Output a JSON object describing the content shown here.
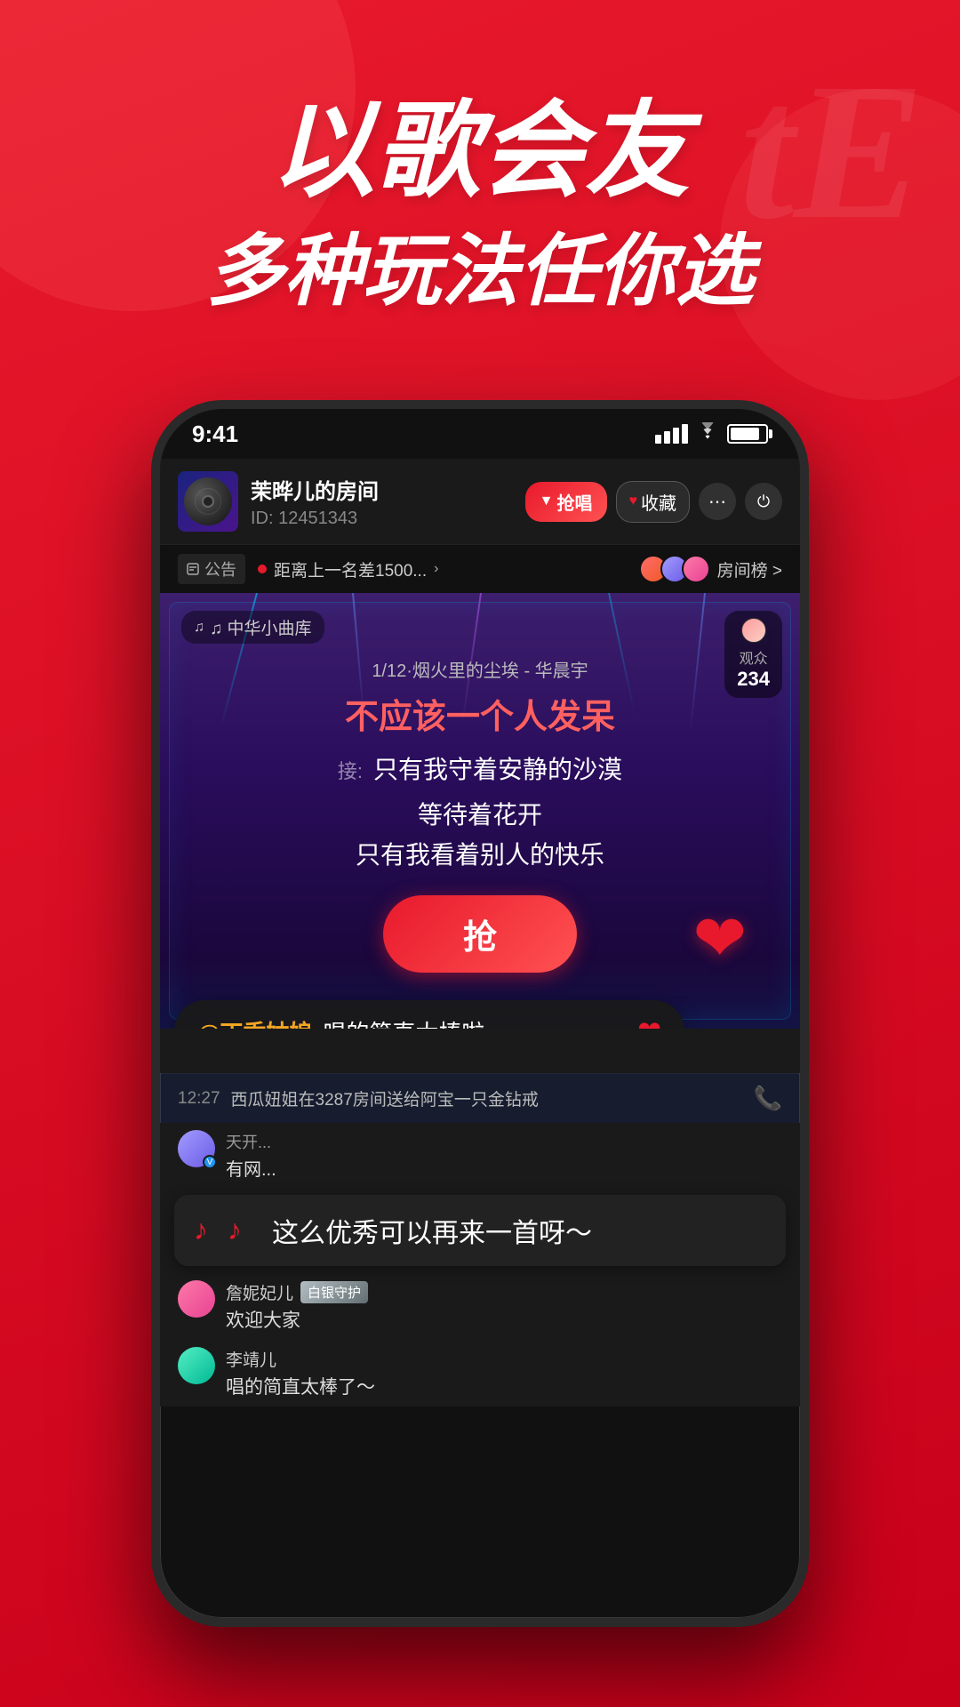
{
  "background": {
    "color": "#e8192c"
  },
  "hero": {
    "line1": "以歌会友",
    "line2": "多种玩法任你选"
  },
  "phone": {
    "status": {
      "time": "9:41"
    },
    "room": {
      "name": "茉晔儿的房间",
      "id": "ID: 12451343",
      "btn_qiang": "抢唱",
      "btn_collect": "收藏",
      "more": "⋯",
      "power": "⏻"
    },
    "notice": {
      "tag": "公告",
      "dot": true,
      "text": "距离上一名差1500...",
      "rank_text": "房间榜 >"
    },
    "karaoke": {
      "lib_badge": "♫ 中华小曲库",
      "song_meta": "1/12·烟火里的尘埃 - 华晨宇",
      "lyric_current": "不应该一个人发呆",
      "next_label": "接:",
      "lyric_next1": "只有我守着安静的沙漠",
      "lyric_next2": "等待着花开",
      "lyric_next3": "只有我看着别人的快乐",
      "grab_btn": "抢"
    },
    "comment": {
      "at_user": "@丁香姑娘",
      "text": " 唱的简直太棒啦"
    },
    "audience": {
      "label": "观众",
      "count": "234"
    },
    "notification": {
      "time": "12:27",
      "text": "西瓜妞姐在3287房间送给阿宝一只金钻戒",
      "icon": "📞"
    },
    "music_popup": {
      "text": "这么优秀可以再来一首呀～"
    },
    "chat": [
      {
        "name": "天开...",
        "badge": "",
        "msg": "有网..."
      },
      {
        "name": "詹妮妃儿",
        "badge": "白银守护",
        "msg": "欢迎大家"
      },
      {
        "name": "李靖儿",
        "badge": "",
        "msg": "唱的简直太棒了～"
      }
    ]
  }
}
